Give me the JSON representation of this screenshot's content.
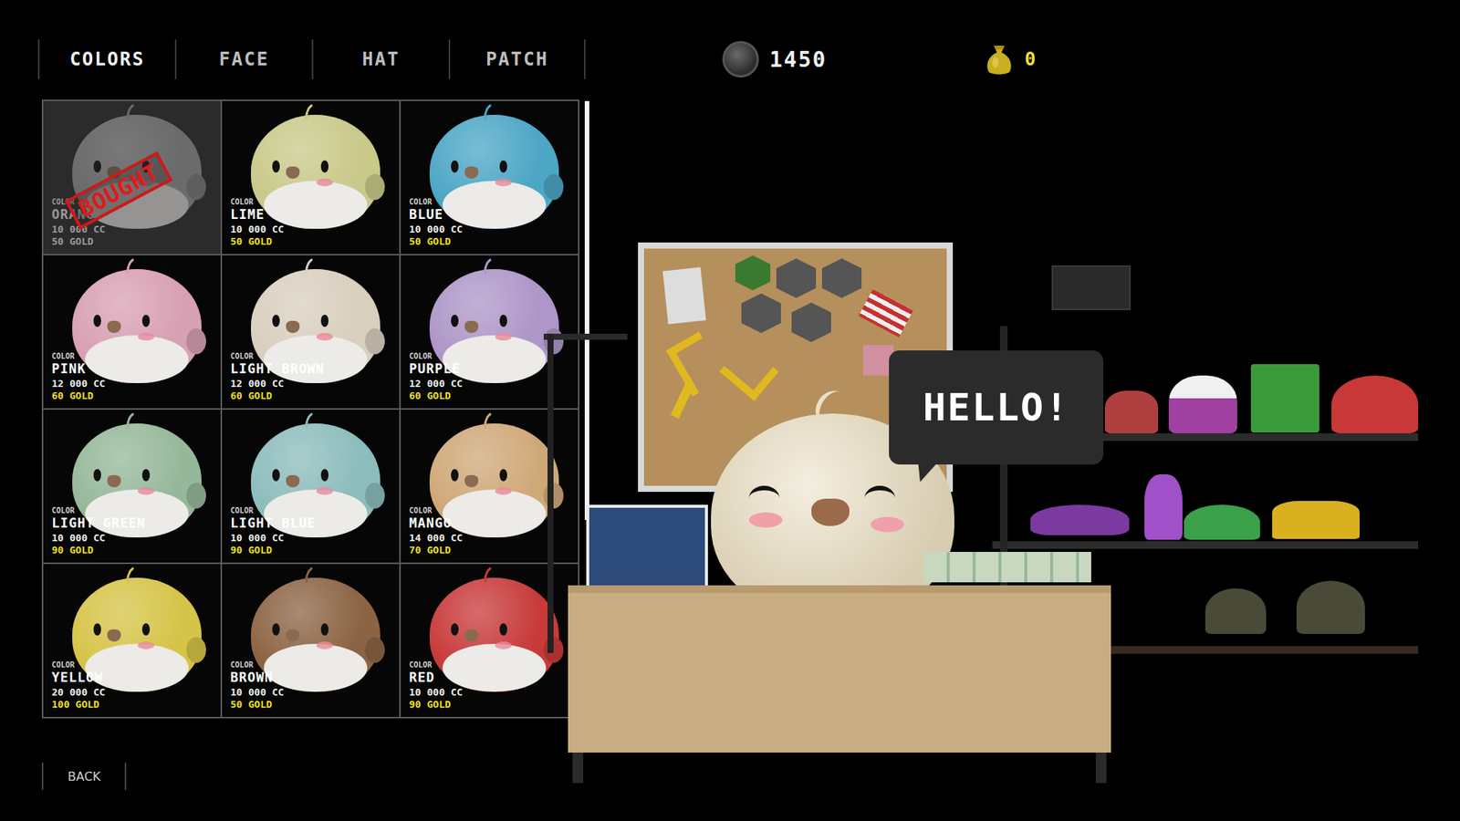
{
  "tabs": [
    {
      "label": "COLORS",
      "selected": true
    },
    {
      "label": "FACE",
      "selected": false
    },
    {
      "label": "HAT",
      "selected": false
    },
    {
      "label": "PATCH",
      "selected": false
    }
  ],
  "wallet": {
    "coins": "1450",
    "gold": "0"
  },
  "bought_stamp": "BOUGHT",
  "scroll": {
    "level": 0.68
  },
  "items": [
    {
      "caption": "COLOR",
      "name": "ORANGE",
      "price_cc": "10 000 CC",
      "price_gold": "50 GOLD",
      "bought": true,
      "color": "#a0a0a0"
    },
    {
      "caption": "COLOR",
      "name": "LIME",
      "price_cc": "10 000 CC",
      "price_gold": "50 GOLD",
      "bought": false,
      "color": "#c9c98a"
    },
    {
      "caption": "COLOR",
      "name": "BLUE",
      "price_cc": "10 000 CC",
      "price_gold": "50 GOLD",
      "bought": false,
      "color": "#4ca6c6"
    },
    {
      "caption": "COLOR",
      "name": "PINK",
      "price_cc": "12 000 CC",
      "price_gold": "60 GOLD",
      "bought": false,
      "color": "#d8a0b4"
    },
    {
      "caption": "COLOR",
      "name": "LIGHT BROWN",
      "price_cc": "12 000 CC",
      "price_gold": "60 GOLD",
      "bought": false,
      "color": "#d9cfbf"
    },
    {
      "caption": "COLOR",
      "name": "PURPLE",
      "price_cc": "12 000 CC",
      "price_gold": "60 GOLD",
      "bought": false,
      "color": "#ae96c8"
    },
    {
      "caption": "COLOR",
      "name": "LIGHT GREEN",
      "price_cc": "10 000 CC",
      "price_gold": "90 GOLD",
      "bought": false,
      "color": "#96b89a"
    },
    {
      "caption": "COLOR",
      "name": "LIGHT BLUE",
      "price_cc": "10 000 CC",
      "price_gold": "90 GOLD",
      "bought": false,
      "color": "#8cbcbc"
    },
    {
      "caption": "COLOR",
      "name": "MANGO",
      "price_cc": "14 000 CC",
      "price_gold": "70 GOLD",
      "bought": false,
      "color": "#cfa878"
    },
    {
      "caption": "COLOR",
      "name": "YELLOW",
      "price_cc": "20 000 CC",
      "price_gold": "100 GOLD",
      "bought": false,
      "color": "#d6c448"
    },
    {
      "caption": "COLOR",
      "name": "BROWN",
      "price_cc": "10 000 CC",
      "price_gold": "50 GOLD",
      "bought": false,
      "color": "#8c6444"
    },
    {
      "caption": "COLOR",
      "name": "RED",
      "price_cc": "10 000 CC",
      "price_gold": "90 GOLD",
      "bought": false,
      "color": "#c83a3a"
    }
  ],
  "back": "BACK",
  "shopkeeper": {
    "speech": "HELLO!"
  }
}
